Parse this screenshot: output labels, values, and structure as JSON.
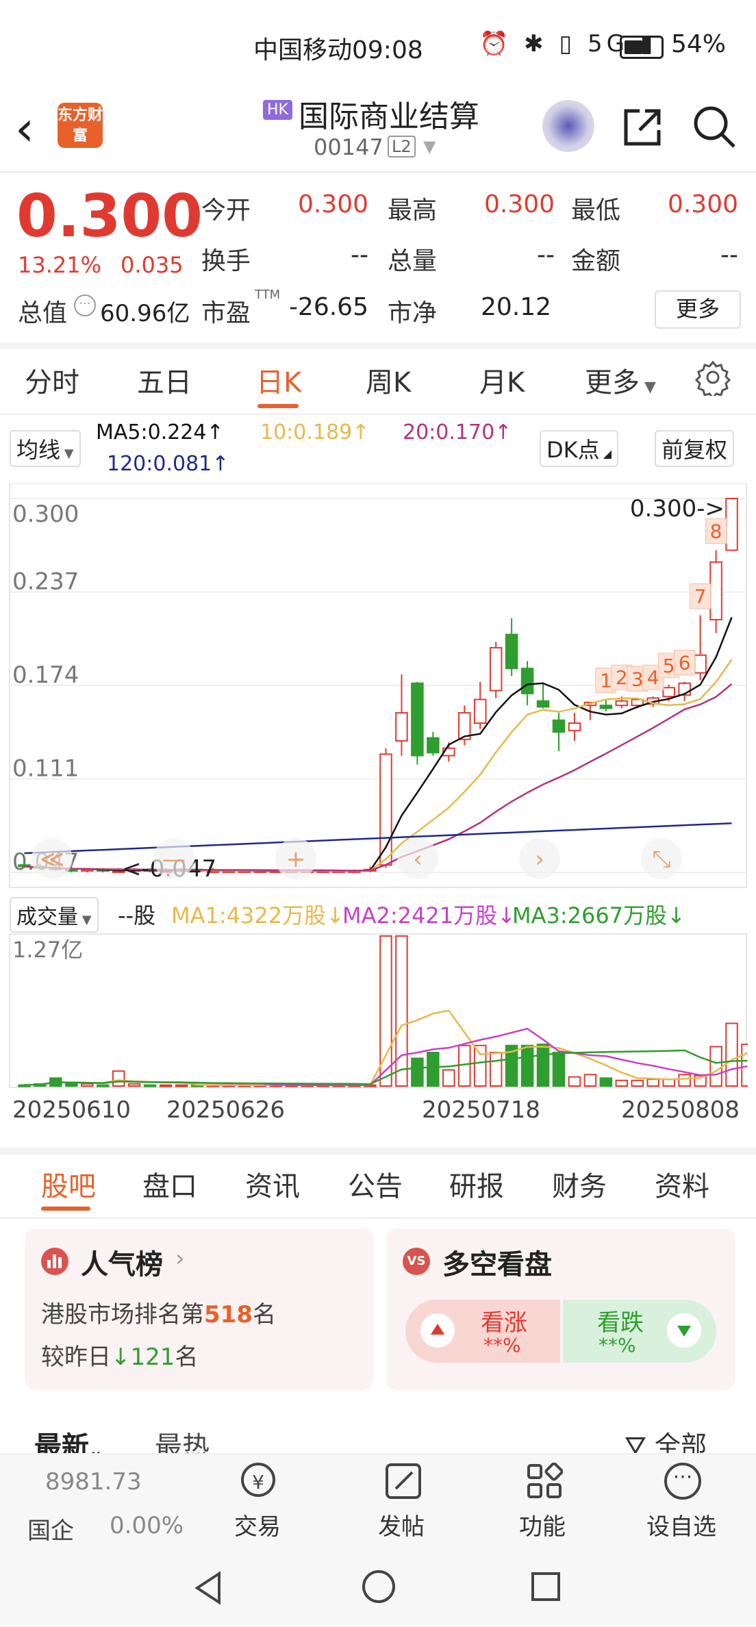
{
  "status_bar": {
    "carrier_time": "中国移动09:08",
    "icons": "⏰ ✱ ▯ 5G ▮",
    "battery": "54%"
  },
  "header": {
    "market_badge": "HK",
    "title": "国际商业结算",
    "code": "00147",
    "level": "L2",
    "logo_text": "东方财富"
  },
  "quote": {
    "price": "0.300",
    "change_pct": "13.21%",
    "change": "0.035",
    "open_label": "今开",
    "open": "0.300",
    "high_label": "最高",
    "high": "0.300",
    "low_label": "最低",
    "low": "0.300",
    "turnover_label": "换手",
    "turnover": "--",
    "volume_label": "总量",
    "volume": "--",
    "amount_label": "金额",
    "amount": "--",
    "mcap_label": "总值",
    "mcap": "60.96亿",
    "pe_label": "市盈",
    "pe_sup": "TTM",
    "pe": "-26.65",
    "pb_label": "市净",
    "pb": "20.12",
    "more_label": "更多"
  },
  "period_tabs": [
    "分时",
    "五日",
    "日K",
    "周K",
    "月K",
    "更多"
  ],
  "ma_legend": {
    "selector": "均线",
    "ma5": "MA5:0.224↑",
    "ma10": "10:0.189↑",
    "ma20": "20:0.170↑",
    "ma120": "120:0.081↑",
    "dk_button": "DK点",
    "adjust_button": "前复权"
  },
  "colors": {
    "up": "#e03a30",
    "down": "#2e9e2e",
    "ma5": "#111111",
    "ma10": "#e8b84a",
    "ma20": "#b8317c",
    "ma120": "#1e2a8a",
    "accent": "#e8612b"
  },
  "chart_data": {
    "type": "candlestick",
    "price_axis_labels": [
      "0.300",
      "0.237",
      "0.174",
      "0.111",
      "0.047"
    ],
    "price_range": [
      0.047,
      0.3
    ],
    "x_tick_labels": [
      "20250610",
      "20250626",
      "20250718",
      "20250808"
    ],
    "high_marker": "0.300->",
    "low_marker": "<-0.047",
    "candles": [
      {
        "o": 0.052,
        "h": 0.054,
        "l": 0.05,
        "c": 0.051
      },
      {
        "o": 0.051,
        "h": 0.053,
        "l": 0.049,
        "c": 0.05
      },
      {
        "o": 0.05,
        "h": 0.052,
        "l": 0.048,
        "c": 0.049
      },
      {
        "o": 0.049,
        "h": 0.051,
        "l": 0.047,
        "c": 0.048
      },
      {
        "o": 0.048,
        "h": 0.05,
        "l": 0.047,
        "c": 0.049
      },
      {
        "o": 0.049,
        "h": 0.05,
        "l": 0.047,
        "c": 0.048
      },
      {
        "o": 0.048,
        "h": 0.05,
        "l": 0.047,
        "c": 0.048
      },
      {
        "o": 0.048,
        "h": 0.05,
        "l": 0.047,
        "c": 0.049
      },
      {
        "o": 0.049,
        "h": 0.05,
        "l": 0.047,
        "c": 0.048
      },
      {
        "o": 0.048,
        "h": 0.05,
        "l": 0.047,
        "c": 0.048
      },
      {
        "o": 0.048,
        "h": 0.05,
        "l": 0.047,
        "c": 0.049
      },
      {
        "o": 0.049,
        "h": 0.05,
        "l": 0.047,
        "c": 0.048
      },
      {
        "o": 0.048,
        "h": 0.05,
        "l": 0.047,
        "c": 0.048
      },
      {
        "o": 0.048,
        "h": 0.049,
        "l": 0.047,
        "c": 0.048
      },
      {
        "o": 0.048,
        "h": 0.049,
        "l": 0.047,
        "c": 0.048
      },
      {
        "o": 0.048,
        "h": 0.049,
        "l": 0.047,
        "c": 0.048
      },
      {
        "o": 0.048,
        "h": 0.049,
        "l": 0.047,
        "c": 0.048
      },
      {
        "o": 0.048,
        "h": 0.049,
        "l": 0.047,
        "c": 0.048
      },
      {
        "o": 0.048,
        "h": 0.049,
        "l": 0.047,
        "c": 0.048
      },
      {
        "o": 0.048,
        "h": 0.049,
        "l": 0.047,
        "c": 0.048
      },
      {
        "o": 0.048,
        "h": 0.049,
        "l": 0.047,
        "c": 0.048
      },
      {
        "o": 0.048,
        "h": 0.049,
        "l": 0.047,
        "c": 0.048
      },
      {
        "o": 0.048,
        "h": 0.051,
        "l": 0.047,
        "c": 0.049
      },
      {
        "o": 0.052,
        "h": 0.131,
        "l": 0.05,
        "c": 0.127
      },
      {
        "o": 0.136,
        "h": 0.181,
        "l": 0.126,
        "c": 0.155
      },
      {
        "o": 0.175,
        "h": 0.176,
        "l": 0.12,
        "c": 0.126
      },
      {
        "o": 0.138,
        "h": 0.142,
        "l": 0.126,
        "c": 0.128
      },
      {
        "o": 0.126,
        "h": 0.135,
        "l": 0.122,
        "c": 0.131
      },
      {
        "o": 0.137,
        "h": 0.16,
        "l": 0.133,
        "c": 0.155
      },
      {
        "o": 0.148,
        "h": 0.176,
        "l": 0.144,
        "c": 0.164
      },
      {
        "o": 0.17,
        "h": 0.203,
        "l": 0.165,
        "c": 0.199
      },
      {
        "o": 0.208,
        "h": 0.219,
        "l": 0.18,
        "c": 0.185
      },
      {
        "o": 0.185,
        "h": 0.19,
        "l": 0.16,
        "c": 0.168
      },
      {
        "o": 0.163,
        "h": 0.175,
        "l": 0.158,
        "c": 0.159
      },
      {
        "o": 0.15,
        "h": 0.155,
        "l": 0.129,
        "c": 0.142
      },
      {
        "o": 0.143,
        "h": 0.155,
        "l": 0.136,
        "c": 0.148
      },
      {
        "o": 0.16,
        "h": 0.162,
        "l": 0.15,
        "c": 0.162
      },
      {
        "o": 0.16,
        "h": 0.164,
        "l": 0.156,
        "c": 0.158
      },
      {
        "o": 0.16,
        "h": 0.166,
        "l": 0.158,
        "c": 0.163
      },
      {
        "o": 0.16,
        "h": 0.165,
        "l": 0.158,
        "c": 0.164
      },
      {
        "o": 0.161,
        "h": 0.166,
        "l": 0.159,
        "c": 0.165
      },
      {
        "o": 0.166,
        "h": 0.174,
        "l": 0.163,
        "c": 0.172
      },
      {
        "o": 0.167,
        "h": 0.176,
        "l": 0.163,
        "c": 0.175
      },
      {
        "o": 0.182,
        "h": 0.221,
        "l": 0.177,
        "c": 0.194
      },
      {
        "o": 0.218,
        "h": 0.265,
        "l": 0.209,
        "c": 0.257
      },
      {
        "o": 0.265,
        "h": 0.3,
        "l": 0.265,
        "c": 0.3
      }
    ],
    "candle_tags": [
      {
        "index": 37,
        "label": "1"
      },
      {
        "index": 38,
        "label": "2"
      },
      {
        "index": 39,
        "label": "3"
      },
      {
        "index": 40,
        "label": "4"
      },
      {
        "index": 41,
        "label": "5"
      },
      {
        "index": 42,
        "label": "6"
      },
      {
        "index": 43,
        "label": "7"
      },
      {
        "index": 44,
        "label": "8"
      }
    ],
    "volume_axis_label": "1.27亿",
    "volume_max": 127000000,
    "volumes": [
      2,
      3,
      8,
      4,
      3,
      2,
      14,
      3,
      2,
      2,
      2,
      2,
      2,
      2,
      2,
      2,
      2,
      2,
      2,
      2,
      2,
      2,
      2,
      130,
      130,
      25,
      30,
      15,
      36,
      36,
      30,
      36,
      36,
      37,
      30,
      9,
      11,
      8,
      6,
      6,
      7,
      7,
      11,
      10,
      35,
      55,
      37
    ],
    "volume_unit": "百万股"
  },
  "volume_legend": {
    "selector": "成交量",
    "current": "--股",
    "ma1": "MA1:4322万股↓",
    "ma2": "MA2:2421万股↓",
    "ma3": "MA3:2667万股↓"
  },
  "info_tabs": [
    "股吧",
    "盘口",
    "资讯",
    "公告",
    "研报",
    "财务",
    "资料"
  ],
  "popularity_card": {
    "title": "人气榜",
    "rank_prefix": "港股市场排名第",
    "rank": "518",
    "rank_suffix": "名",
    "change_prefix": "较昨日",
    "change": "121",
    "change_suffix": "名"
  },
  "sentiment_card": {
    "title": "多空看盘",
    "badge": "VS",
    "up_label": "看涨",
    "up_value": "**%",
    "down_label": "看跌",
    "down_value": "**%"
  },
  "feed_tabs": {
    "latest": "最新",
    "hot": "最热",
    "filter": "全部"
  },
  "bottom_bar": {
    "index_value": "8981.73",
    "index_name": "国企",
    "index_change": "0.00%",
    "trade": "交易",
    "post": "发帖",
    "functions": "功能",
    "watchlist": "设自选"
  }
}
